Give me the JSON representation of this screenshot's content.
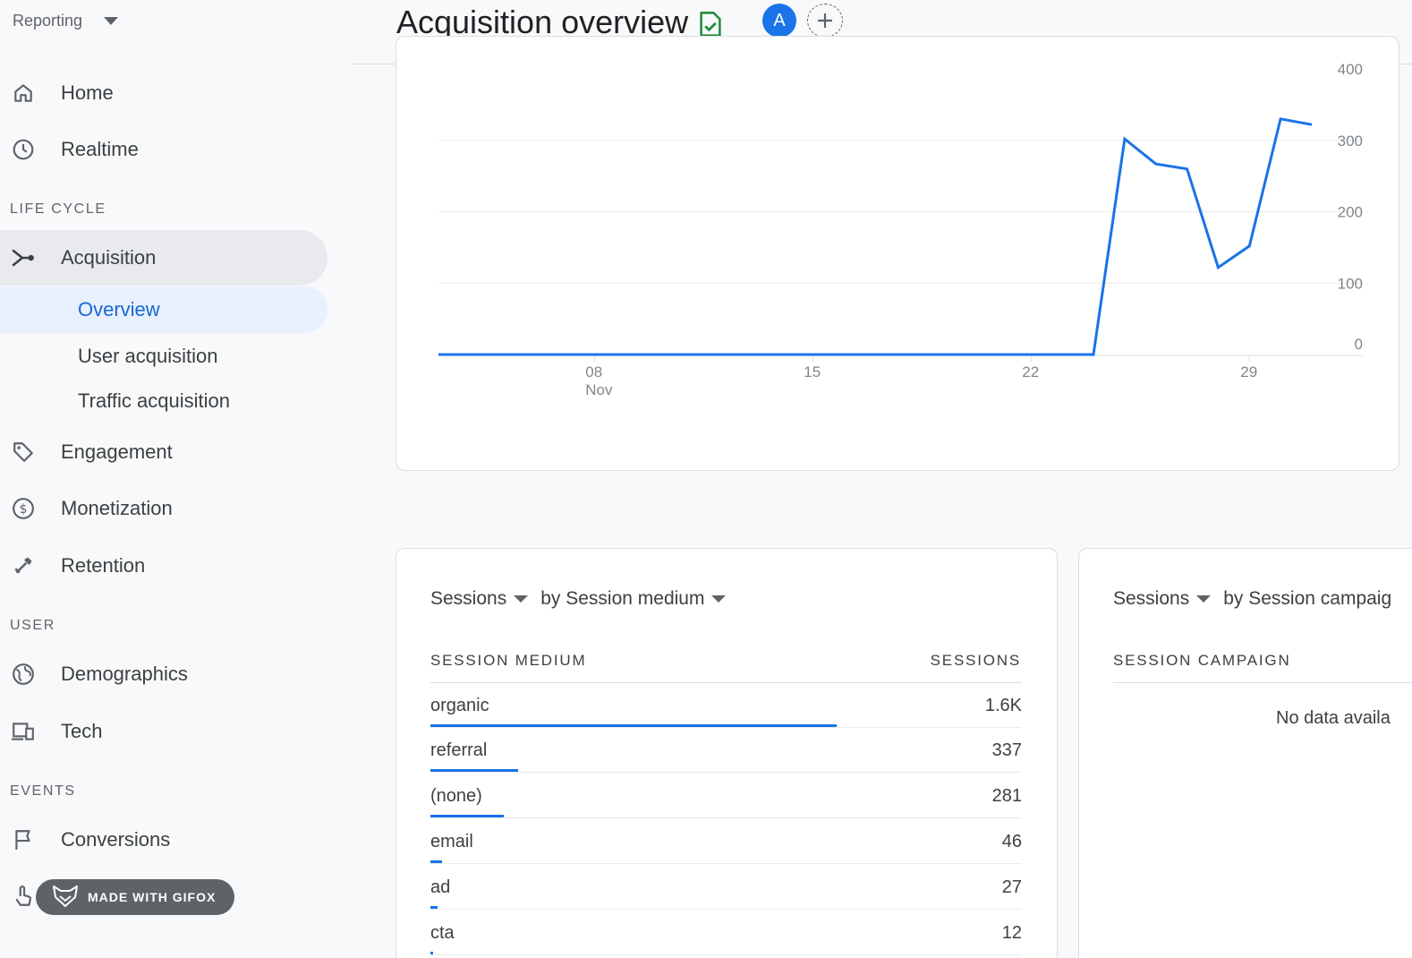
{
  "sidebar": {
    "reporting_label": "Reporting",
    "home": "Home",
    "realtime": "Realtime",
    "section_lifecycle": "LIFE CYCLE",
    "acquisition": "Acquisition",
    "overview": "Overview",
    "user_acquisition": "User acquisition",
    "traffic_acquisition": "Traffic acquisition",
    "engagement": "Engagement",
    "monetization": "Monetization",
    "retention": "Retention",
    "section_user": "USER",
    "demographics": "Demographics",
    "tech": "Tech",
    "section_events": "EVENTS",
    "conversions": "Conversions"
  },
  "watermark": {
    "label": "MADE WITH GIFOX"
  },
  "header": {
    "title": "Acquisition overview",
    "avatar_letter": "A"
  },
  "chart_data": {
    "type": "line",
    "x_tick_labels": [
      "08",
      "15",
      "22",
      "29"
    ],
    "x_month_label": "Nov",
    "y_ticks": [
      0,
      100,
      200,
      300,
      400
    ],
    "ylim": [
      0,
      400
    ],
    "grid": true,
    "series": [
      {
        "x": [
          "Nov 3",
          "Nov 4",
          "Nov 5",
          "Nov 6",
          "Nov 7",
          "Nov 8",
          "Nov 9",
          "Nov 10",
          "Nov 11",
          "Nov 12",
          "Nov 13",
          "Nov 14",
          "Nov 15",
          "Nov 16",
          "Nov 17",
          "Nov 18",
          "Nov 19",
          "Nov 20",
          "Nov 21",
          "Nov 22",
          "Nov 23",
          "Nov 24",
          "Nov 25",
          "Nov 26",
          "Nov 27",
          "Nov 28",
          "Nov 29",
          "Nov 30",
          "Dec 1"
        ],
        "values": [
          0,
          0,
          0,
          0,
          0,
          0,
          0,
          0,
          0,
          0,
          0,
          0,
          0,
          0,
          0,
          0,
          0,
          0,
          0,
          0,
          0,
          0,
          302,
          267,
          260,
          122,
          152,
          330,
          322
        ],
        "color": "#1a73e8"
      }
    ]
  },
  "medium_card": {
    "metric": "Sessions",
    "dimension": "by Session medium",
    "col_dimension": "SESSION MEDIUM",
    "col_metric": "SESSIONS",
    "rows": [
      {
        "name": "organic",
        "value": "1.6K",
        "share": 0.687
      },
      {
        "name": "referral",
        "value": "337",
        "share": 0.148
      },
      {
        "name": "(none)",
        "value": "281",
        "share": 0.124
      },
      {
        "name": "email",
        "value": "46",
        "share": 0.02
      },
      {
        "name": "ad",
        "value": "27",
        "share": 0.012
      },
      {
        "name": "cta",
        "value": "12",
        "share": 0.005
      }
    ]
  },
  "campaign_card": {
    "metric": "Sessions",
    "dimension": "by Session campaig",
    "col_dimension": "SESSION CAMPAIGN",
    "empty_text": "No data availa"
  }
}
